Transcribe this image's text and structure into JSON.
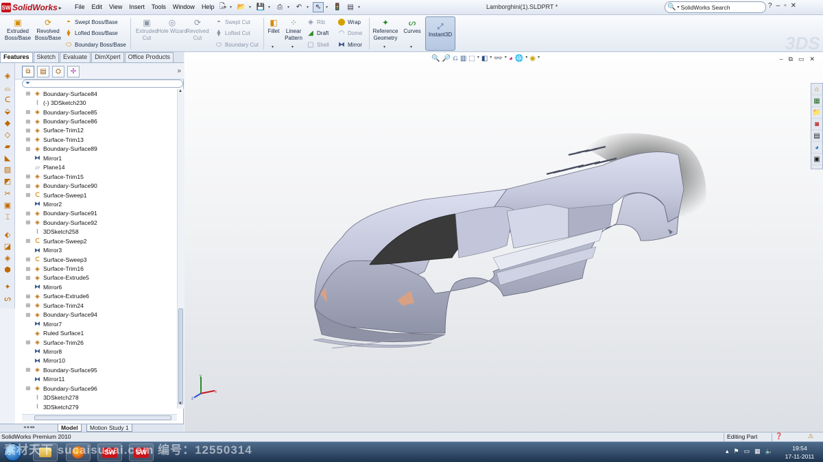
{
  "app": {
    "name": "SolidWorks",
    "doc_title": "Lamborghini(1).SLDPRT *"
  },
  "menu": [
    "File",
    "Edit",
    "View",
    "Insert",
    "Tools",
    "Window",
    "Help"
  ],
  "search": {
    "placeholder": "SolidWorks Search"
  },
  "window_controls": [
    "?",
    "–",
    "▫",
    "✕"
  ],
  "commands": {
    "extruded_boss": "Extruded Boss/Base",
    "revolved_boss": "Revolved Boss/Base",
    "swept_boss": "Swept Boss/Base",
    "lofted_boss": "Lofted Boss/Base",
    "boundary_boss": "Boundary Boss/Base",
    "extruded_cut": "Extruded Cut",
    "hole_wizard": "Hole Wizard",
    "revolved_cut": "Revolved Cut",
    "swept_cut": "Swept Cut",
    "lofted_cut": "Lofted Cut",
    "boundary_cut": "Boundary Cut",
    "fillet": "Fillet",
    "linear_pattern": "Linear Pattern",
    "rib": "Rib",
    "draft": "Draft",
    "shell": "Shell",
    "wrap": "Wrap",
    "dome": "Dome",
    "mirror": "Mirror",
    "reference_geometry": "Reference Geometry",
    "curves": "Curves",
    "instant3d": "Instant3D"
  },
  "tabs": [
    "Features",
    "Sketch",
    "Evaluate",
    "DimXpert",
    "Office Products"
  ],
  "tree": [
    {
      "label": "Boundary-Surface84",
      "type": "surf",
      "expand": true
    },
    {
      "label": "(-) 3DSketch230",
      "type": "sketch",
      "expand": false
    },
    {
      "label": "Boundary-Surface85",
      "type": "surf",
      "expand": true
    },
    {
      "label": "Boundary-Surface86",
      "type": "surf",
      "expand": true
    },
    {
      "label": "Surface-Trim12",
      "type": "surf",
      "expand": true
    },
    {
      "label": "Surface-Trim13",
      "type": "surf",
      "expand": true
    },
    {
      "label": "Boundary-Surface89",
      "type": "surf",
      "expand": true
    },
    {
      "label": "Mirror1",
      "type": "mirror",
      "expand": false
    },
    {
      "label": "Plane14",
      "type": "plane",
      "expand": false
    },
    {
      "label": "Surface-Trim15",
      "type": "surf",
      "expand": true
    },
    {
      "label": "Boundary-Surface90",
      "type": "surf",
      "expand": true
    },
    {
      "label": "Surface-Sweep1",
      "type": "sweep",
      "expand": true
    },
    {
      "label": "Mirror2",
      "type": "mirror",
      "expand": false
    },
    {
      "label": "Boundary-Surface91",
      "type": "surf",
      "expand": true
    },
    {
      "label": "Boundary-Surface92",
      "type": "surf",
      "expand": true
    },
    {
      "label": "3DSketch258",
      "type": "sketch",
      "expand": false
    },
    {
      "label": "Surface-Sweep2",
      "type": "sweep",
      "expand": true
    },
    {
      "label": "Mirror3",
      "type": "mirror",
      "expand": false
    },
    {
      "label": "Surface-Sweep3",
      "type": "sweep",
      "expand": true
    },
    {
      "label": "Surface-Trim16",
      "type": "surf",
      "expand": true
    },
    {
      "label": "Surface-Extrude5",
      "type": "surf",
      "expand": true
    },
    {
      "label": "Mirror6",
      "type": "mirror",
      "expand": false
    },
    {
      "label": "Surface-Extrude6",
      "type": "surf",
      "expand": true
    },
    {
      "label": "Surface-Trim24",
      "type": "surf",
      "expand": true
    },
    {
      "label": "Boundary-Surface94",
      "type": "surf",
      "expand": true
    },
    {
      "label": "Mirror7",
      "type": "mirror",
      "expand": false
    },
    {
      "label": "Ruled Surface1",
      "type": "surf",
      "expand": false
    },
    {
      "label": "Surface-Trim26",
      "type": "surf",
      "expand": true
    },
    {
      "label": "Mirror8",
      "type": "mirror",
      "expand": false
    },
    {
      "label": "Mirror10",
      "type": "mirror",
      "expand": false
    },
    {
      "label": "Boundary-Surface95",
      "type": "surf",
      "expand": true
    },
    {
      "label": "Mirror11",
      "type": "mirror",
      "expand": false
    },
    {
      "label": "Boundary-Surface96",
      "type": "surf",
      "expand": true
    },
    {
      "label": "3DSketch278",
      "type": "sketch",
      "expand": false
    },
    {
      "label": "3DSketch279",
      "type": "sketch",
      "expand": false
    }
  ],
  "model_tabs": [
    "Model",
    "Motion Study 1"
  ],
  "status": {
    "left": "SolidWorks Premium 2010",
    "right": "Editing Part"
  },
  "clock": {
    "time": "19:54",
    "date": "17-11-2011"
  },
  "watermark": "素材天下 sucaisucai.com  编号：12550314",
  "colors": {
    "body": "#c9ccdf",
    "glass": "#3a3a3a",
    "headlight": "#d9a184",
    "accent": "#c8141b"
  }
}
